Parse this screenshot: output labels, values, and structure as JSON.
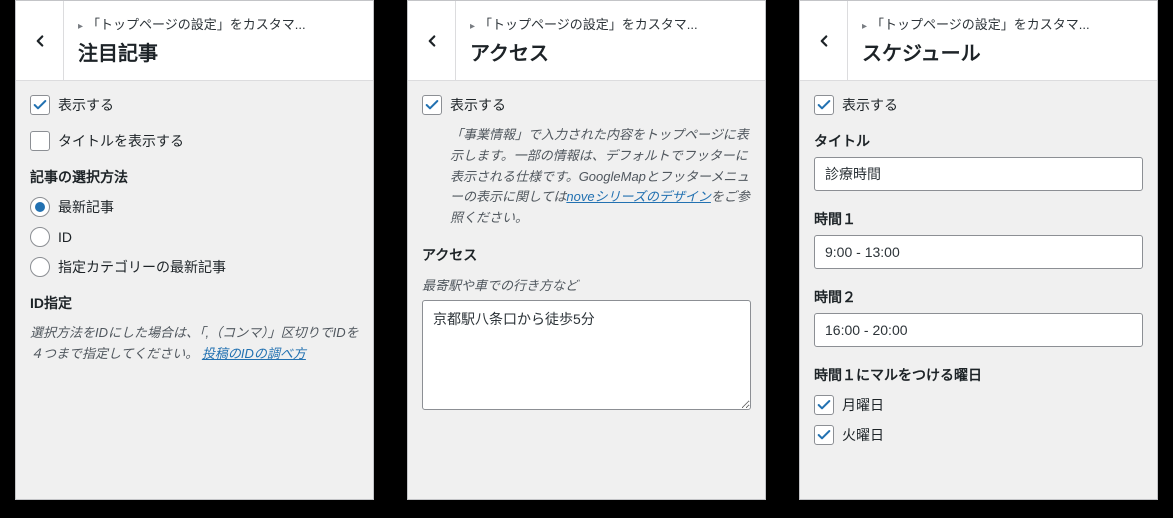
{
  "panels": {
    "p1": {
      "breadcrumb": "「トップページの設定」をカスタマ...",
      "title": "注目記事",
      "show_label": "表示する",
      "show_checked": true,
      "show_title_label": "タイトルを表示する",
      "show_title_checked": false,
      "select_method_heading": "記事の選択方法",
      "radio_latest": "最新記事",
      "radio_id": "ID",
      "radio_category": "指定カテゴリーの最新記事",
      "radio_selected": "latest",
      "id_heading": "ID指定",
      "id_desc_1": "選択方法をIDにした場合は、「,（コンマ）」区切りでIDを４つまで指定してください。",
      "id_desc_link": "投稿のIDの調べ方"
    },
    "p2": {
      "breadcrumb": "「トップページの設定」をカスタマ...",
      "title": "アクセス",
      "show_label": "表示する",
      "show_checked": true,
      "desc_pre": "「事業情報」で入力された内容をトップページに表示します。一部の情報は、デフォルトでフッターに表示される仕様です。GoogleMapとフッターメニューの表示に関しては",
      "desc_link": "noveシリーズのデザイン",
      "desc_post": "をご参照ください。",
      "access_heading": "アクセス",
      "access_sublabel": "最寄駅や車での行き方など",
      "access_value": "京都駅八条口から徒歩5分"
    },
    "p3": {
      "breadcrumb": "「トップページの設定」をカスタマ...",
      "title": "スケジュール",
      "show_label": "表示する",
      "show_checked": true,
      "title_field_label": "タイトル",
      "title_field_value": "診療時間",
      "time1_label": "時間１",
      "time1_value": "9:00 - 13:00",
      "time2_label": "時間２",
      "time2_value": "16:00 - 20:00",
      "days_heading": "時間１にマルをつける曜日",
      "day_mon": "月曜日",
      "day_mon_checked": true,
      "day_tue": "火曜日",
      "day_tue_checked": true
    }
  }
}
